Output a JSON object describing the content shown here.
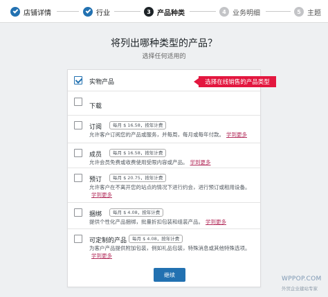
{
  "stepper": {
    "steps": [
      {
        "num": "",
        "label": "店铺详情",
        "state": "done"
      },
      {
        "num": "",
        "label": "行业",
        "state": "done"
      },
      {
        "num": "3",
        "label": "产品种类",
        "state": "active"
      },
      {
        "num": "4",
        "label": "业务明细",
        "state": "future"
      },
      {
        "num": "5",
        "label": "主题",
        "state": "future"
      }
    ]
  },
  "header": {
    "title": "将列出哪种类型的产品？",
    "subtitle": "选择任何适用的"
  },
  "options": [
    {
      "label": "实物产品",
      "checked": true,
      "price": "",
      "desc": "",
      "more": ""
    },
    {
      "label": "下载",
      "checked": false,
      "price": "",
      "desc": "",
      "more": ""
    },
    {
      "label": "订阅",
      "checked": false,
      "price": "每月 $ 16.58，按年计费",
      "desc": "允许客户订阅您的产品或服务，并每周，每月或每年付款。",
      "more": "学到更多"
    },
    {
      "label": "成员",
      "checked": false,
      "price": "每月 $ 16.58，按年计费",
      "desc": "允许会员免费或收费使用受限内容或产品。",
      "more": "学到更多"
    },
    {
      "label": "预订",
      "checked": false,
      "price": "每月 $ 20.75，按年计费",
      "desc": "允许客户在不离开您的站点的情况下进行约会，进行预订或租用设备。",
      "more": "学到更多"
    },
    {
      "label": "捆绑",
      "checked": false,
      "price": "每月 $ 4.08，按年计费",
      "desc": "提供个性化产品捆绑，批量折扣包装和组装产品。",
      "more": "学到更多"
    },
    {
      "label": "可定制的产品",
      "checked": false,
      "price": "每月 $ 4.08，按年计费",
      "desc": "为客户产品提供附加包装，例如礼品包装，特殊消息或其他特殊选项。",
      "more": "学到更多"
    }
  ],
  "callout": "选择在线销售的产品类型",
  "continue_label": "继续",
  "watermark": {
    "main": "WPPOP.COM",
    "sub": "外贸企业建站专家"
  },
  "colors": {
    "primary": "#2271b1",
    "callout": "#e3173f",
    "link": "#b32d5b"
  }
}
